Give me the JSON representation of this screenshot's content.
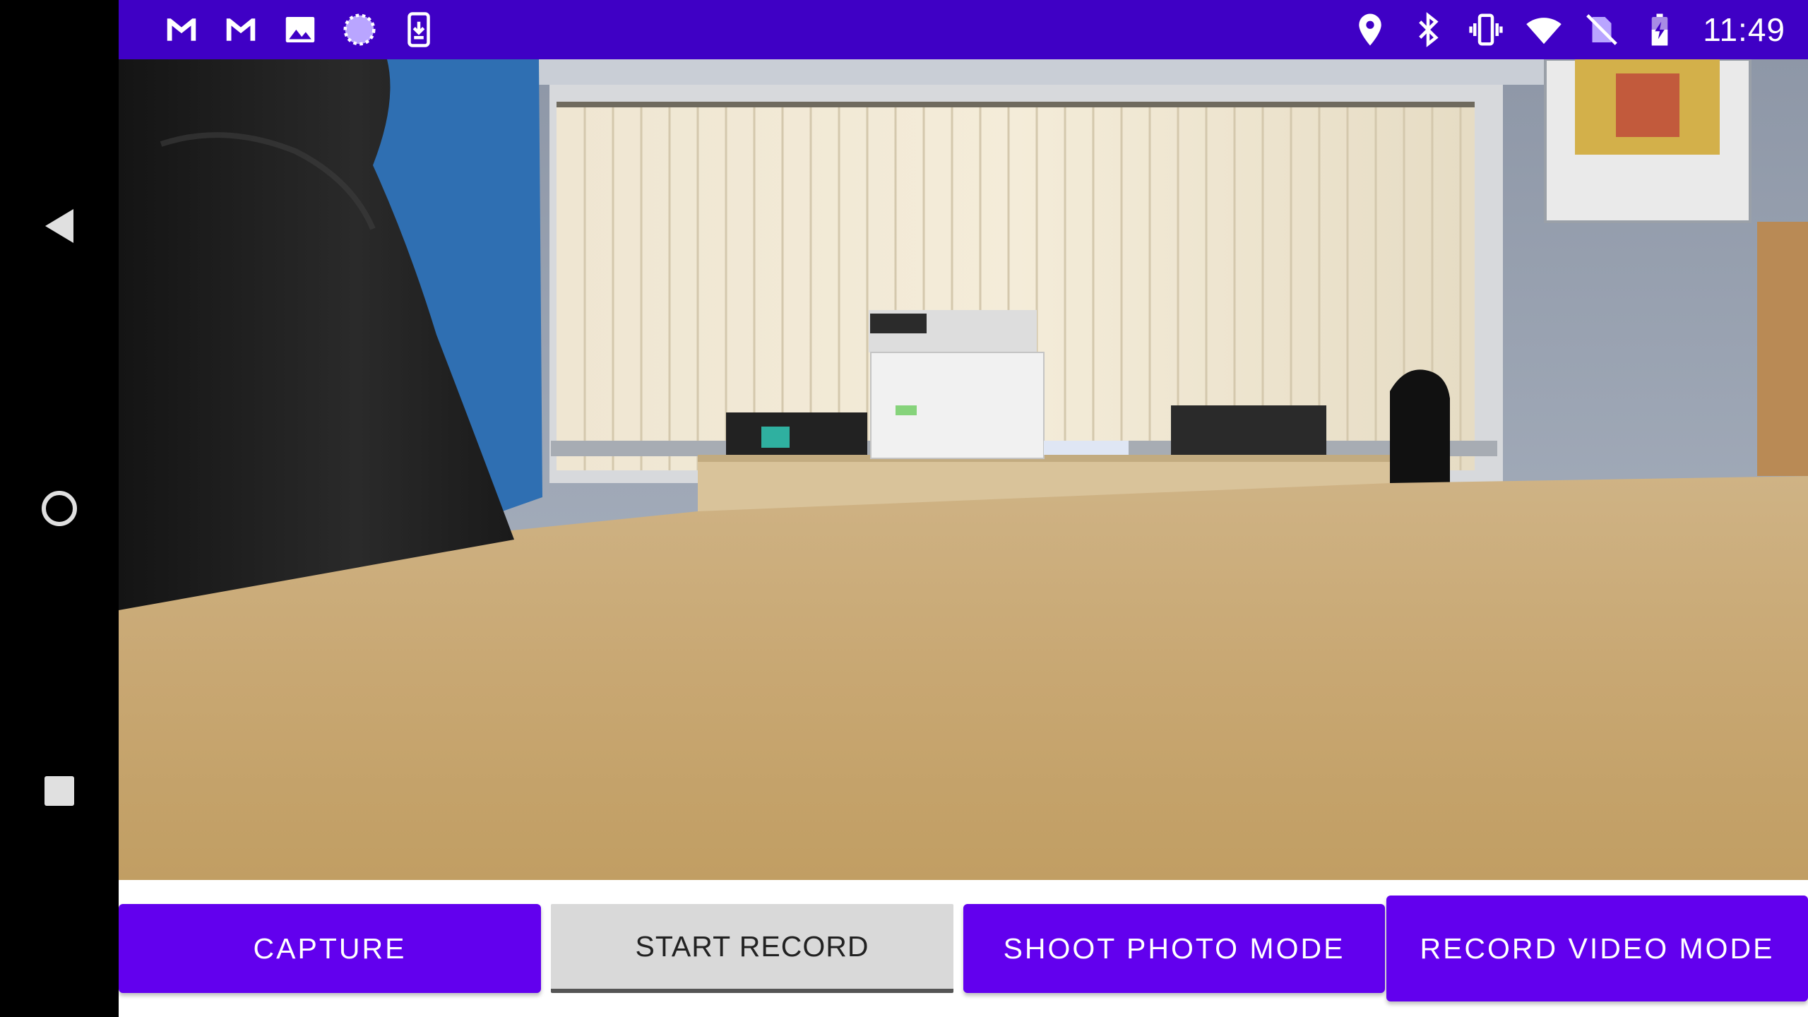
{
  "status_bar": {
    "left_icons": [
      "gmail-icon",
      "gmail-icon",
      "gallery-icon",
      "sync-icon",
      "download-icon"
    ],
    "right_icons": [
      "location-icon",
      "bluetooth-icon",
      "vibrate-icon",
      "wifi-icon",
      "no-sim-icon",
      "battery-charging-icon"
    ],
    "time": "11:49",
    "color": "#3f00c5"
  },
  "nav_bar": {
    "items": [
      "back-icon",
      "home-icon",
      "recents-icon"
    ]
  },
  "preview": {
    "description_icon": "camera-preview"
  },
  "controls": {
    "capture_label": "CAPTURE",
    "start_record_label": "START RECORD",
    "shoot_photo_mode_label": "SHOOT PHOTO MODE",
    "record_video_mode_label": "RECORD VIDEO MODE",
    "accent_color": "#6200ee"
  }
}
